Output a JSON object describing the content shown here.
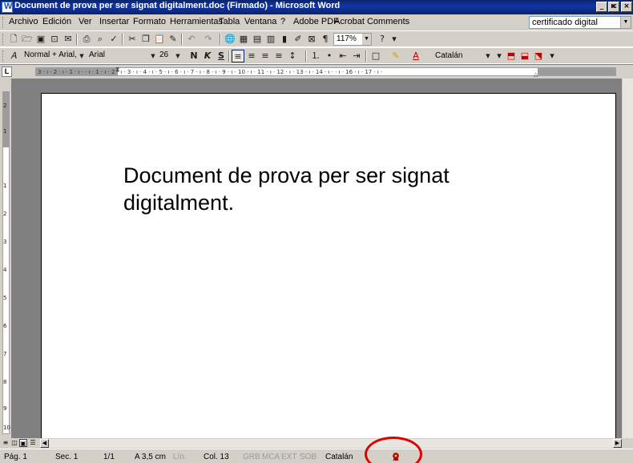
{
  "window": {
    "title": "Document de prova per ser signat digitalment.doc (Firmado) - Microsoft Word",
    "controls": {
      "minimize": "_",
      "restore": "ѥ",
      "close": "×"
    }
  },
  "menu": {
    "items": [
      "Archivo",
      "Edición",
      "Ver",
      "Insertar",
      "Formato",
      "Herramientas",
      "Tabla",
      "Ventana",
      "?",
      "Adobe PDF",
      "Acrobat Comments"
    ],
    "help_box_value": "certificado digital"
  },
  "standard_toolbar": {
    "zoom": "117%"
  },
  "formatting_toolbar": {
    "style": "Normal + Arial,",
    "font": "Arial",
    "size": "26",
    "bold": "N",
    "italic": "K",
    "underline": "S",
    "language": "Catalán"
  },
  "ruler": {
    "tab_selector": "L",
    "labels": "3 · ı · 2 · ı · 1 · ı ·   · ı · 1 · ı · 2 · ı · 3 · ı · 4 · ı · 5 · ı · 6 · ı · 7 · ı · 8 · ı · 9 · ı · 10 · ı · 11 · ı · 12 · ı · 13 · ı · 14 · ı ·   · ı · 16 · ı · 17 · ı ·",
    "vertical_numbers": [
      "2",
      "1",
      "1",
      "2",
      "3",
      "4",
      "5",
      "6",
      "7",
      "8",
      "9",
      "10"
    ]
  },
  "document": {
    "line1": "Document de prova per ser signat",
    "line2": "digitalment."
  },
  "status": {
    "page": "Pág. 1",
    "section": "Sec. 1",
    "pages": "1/1",
    "at": "A 3,5 cm",
    "line": "Lín.",
    "col": "Col. 13",
    "grb": "GRB",
    "mca": "MCA",
    "ext": "EXT",
    "sob": "SOB",
    "language": "Catalán"
  },
  "colors": {
    "titlebar": "#0a246a",
    "chrome": "#d4d0c8",
    "doc_background": "#808080",
    "highlight_circle": "#e00000"
  }
}
